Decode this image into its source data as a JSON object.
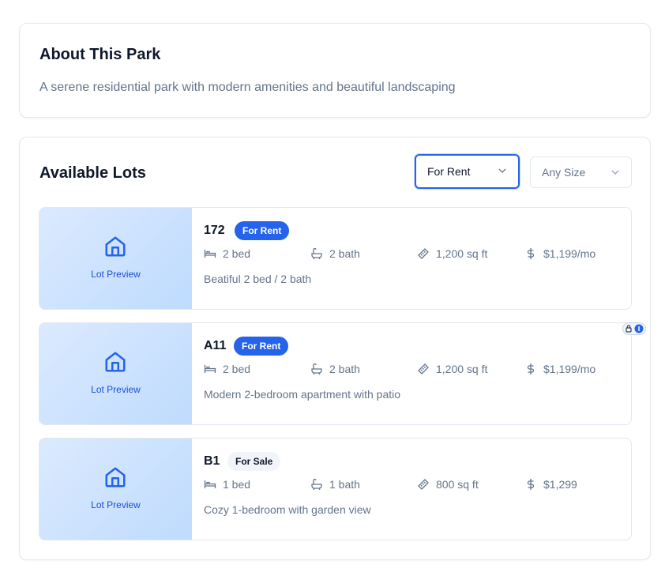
{
  "about": {
    "title": "About This Park",
    "description": "A serene residential park with modern amenities and beautiful landscaping"
  },
  "lots_section": {
    "title": "Available Lots",
    "type_filter": {
      "selected": "For Rent"
    },
    "size_filter": {
      "selected": "Any Size"
    }
  },
  "lots": [
    {
      "id": "172",
      "status": "For Rent",
      "status_kind": "rent",
      "beds": "2 bed",
      "baths": "2 bath",
      "area": "1,200 sq ft",
      "price": "$1,199/mo",
      "preview_label": "Lot Preview",
      "description": "Beatiful 2 bed / 2 bath"
    },
    {
      "id": "A11",
      "status": "For Rent",
      "status_kind": "rent",
      "beds": "2 bed",
      "baths": "2 bath",
      "area": "1,200 sq ft",
      "price": "$1,199/mo",
      "preview_label": "Lot Preview",
      "description": "Modern 2-bedroom apartment with patio"
    },
    {
      "id": "B1",
      "status": "For Sale",
      "status_kind": "sale",
      "beds": "1 bed",
      "baths": "1 bath",
      "area": "800 sq ft",
      "price": "$1,299",
      "preview_label": "Lot Preview",
      "description": "Cozy 1-bedroom with garden view"
    }
  ],
  "colors": {
    "accent": "#2563eb",
    "muted_text": "#64748b",
    "preview_bg": "#dbeafe"
  },
  "icons": {
    "preview": "house-icon",
    "beds": "bed-icon",
    "baths": "bath-icon",
    "area": "ruler-icon",
    "price": "dollar-icon"
  }
}
